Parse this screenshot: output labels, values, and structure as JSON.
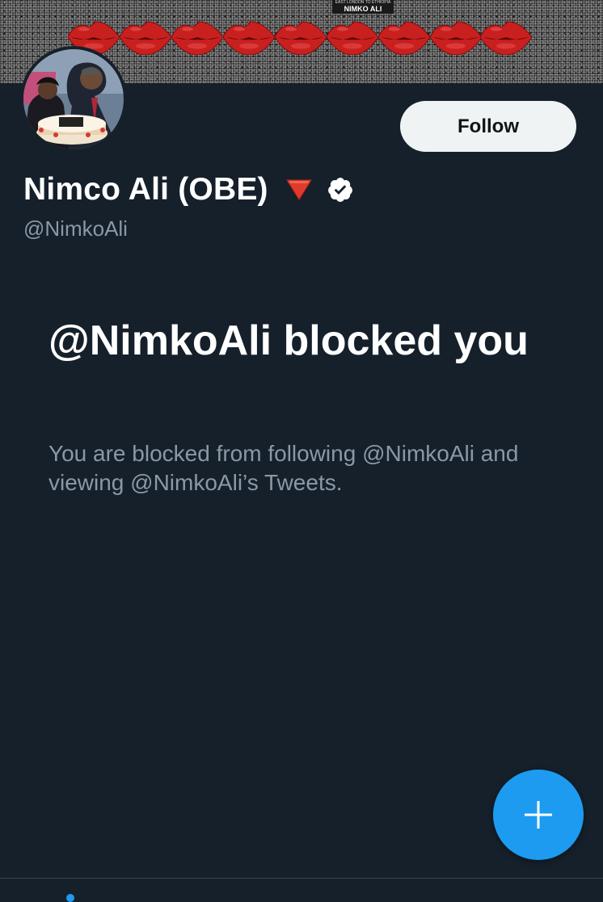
{
  "banner": {
    "badge_subtitle": "EAST LONDON TO ETHIOPIA",
    "badge_title": "NIMKO ALI"
  },
  "profile": {
    "display_name": "Nimco Ali (OBE)",
    "handle": "@NimkoAli",
    "follow_label": "Follow",
    "emoji_icon": "red-triangle-down-icon",
    "verified_icon": "verified-badge-icon"
  },
  "blocked": {
    "title": "@NimkoAli blocked you",
    "description": "You are blocked from following @NimkoAli and viewing @NimkoAli’s Tweets."
  },
  "fab": {
    "icon": "plus-icon"
  },
  "colors": {
    "background": "#15202b",
    "secondary_text": "#8b98a5",
    "accent": "#1d9bf0",
    "follow_button_bg": "#eff3f4",
    "follow_button_text": "#0f1419",
    "lips": "#c8201f"
  }
}
